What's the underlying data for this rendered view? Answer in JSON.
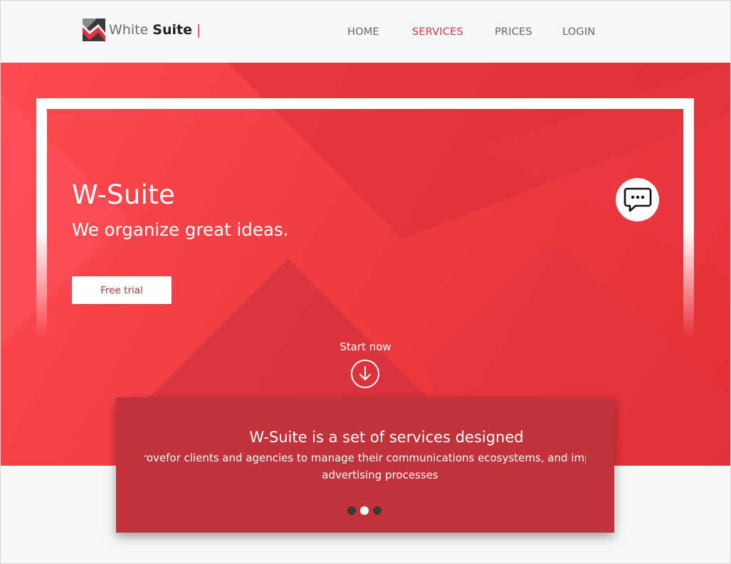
{
  "header": {
    "brand_light": "White ",
    "brand_bold": "Suite",
    "brand_cursor": "|",
    "nav": {
      "home": "HOME",
      "services": "SERVICES",
      "prices": "PRICES",
      "login": "LOGIN",
      "active": "SERVICES"
    }
  },
  "hero": {
    "title": "W-Suite",
    "subtitle": "We organize great ideas.",
    "cta_label": "Free trial",
    "chat_icon": "chat-bubble-icon",
    "start_label": "Start now",
    "start_icon": "arrow-down-circle-icon"
  },
  "card": {
    "title": "W-Suite is a set of services designed",
    "line1": "rovefor clients and agencies to manage their communications ecosystems, and impr",
    "line2": "advertising processes",
    "carousel": {
      "count": 3,
      "active_index": 1
    }
  },
  "colors": {
    "accent": "#e4343f",
    "hero_red": "#f23c44",
    "card_red": "#c2323a",
    "nav_active": "#d7343d"
  }
}
